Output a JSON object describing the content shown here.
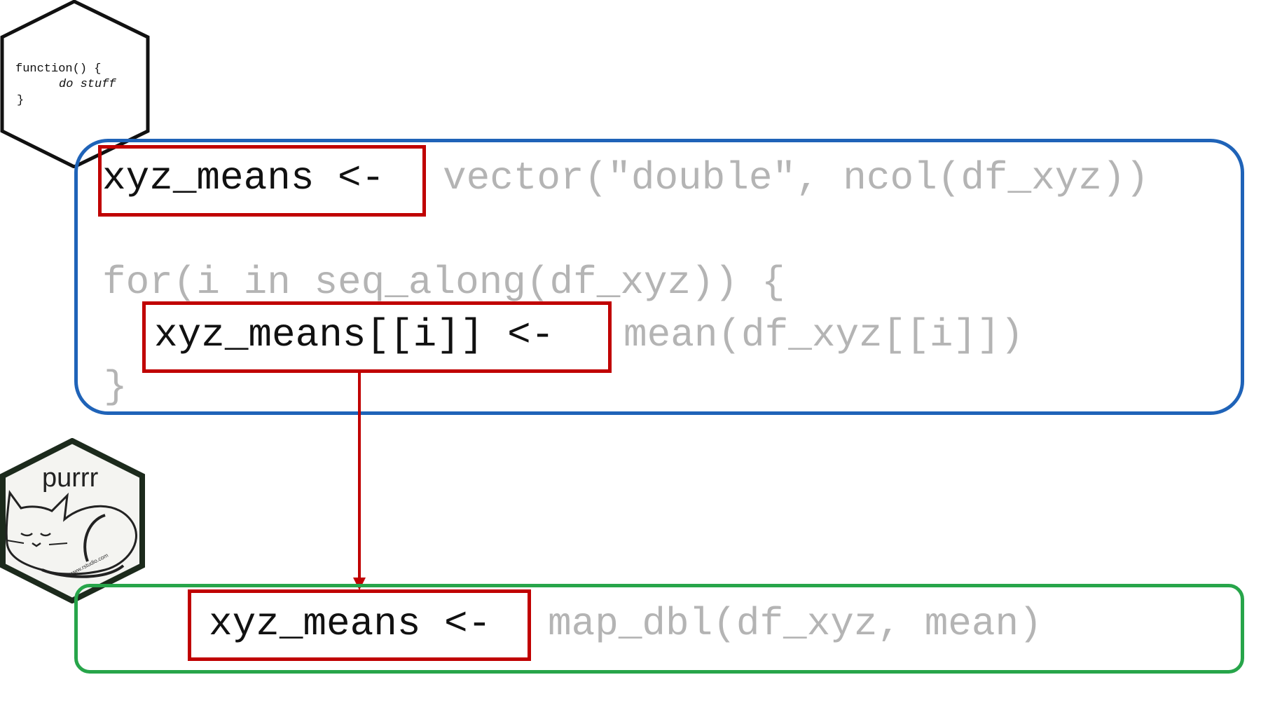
{
  "function_hex": {
    "line1": "function() {",
    "line2": "do stuff",
    "line3": "}"
  },
  "loop_block": {
    "line1_highlight": "xyz_means <-",
    "line1_rest": "vector(\"double\", ncol(df_xyz))",
    "line2": "for(i in seq_along(df_xyz)) {",
    "line3_highlight": "xyz_means[[i]] <-",
    "line3_rest": "mean(df_xyz[[i]])",
    "line4": "}"
  },
  "purrr_hex": {
    "label": "purrr",
    "footer": "www.rstudio.com"
  },
  "map_block": {
    "highlight": "xyz_means <-",
    "rest": "map_dbl(df_xyz, mean)"
  },
  "colors": {
    "loop_border": "#1f63b8",
    "map_border": "#27a54a",
    "highlight_border": "#c00000",
    "arrow": "#c00000",
    "code_emphasis": "#111111",
    "code_muted": "#b4b4b4"
  }
}
